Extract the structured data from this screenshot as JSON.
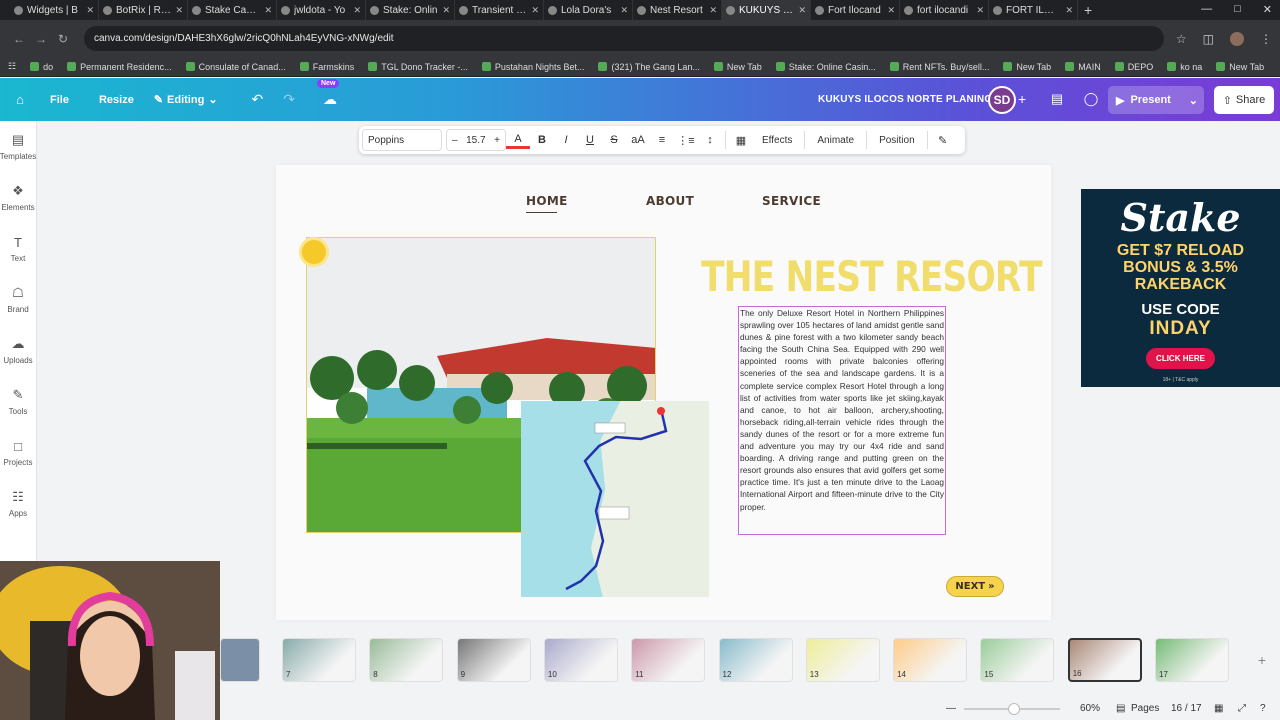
{
  "browser": {
    "tabs": [
      {
        "label": "Widgets | B",
        "active": false
      },
      {
        "label": "BotRix | Raffl",
        "active": false
      },
      {
        "label": "Stake Casino",
        "active": false
      },
      {
        "label": "jwldota - Yo",
        "active": false
      },
      {
        "label": "Stake: Onlin",
        "active": false
      },
      {
        "label": "Transient Ho",
        "active": false
      },
      {
        "label": "Lola Dora's",
        "active": false
      },
      {
        "label": "Nest Resort",
        "active": false
      },
      {
        "label": "KUKUYS ILC",
        "active": true
      },
      {
        "label": "Fort Ilocand",
        "active": false
      },
      {
        "label": "fort ilocandi",
        "active": false
      },
      {
        "label": "FORT ILOCA",
        "active": false
      }
    ],
    "url": "canva.com/design/DAHE3hX6glw/2ricQ0hNLah4EyVNG-xNWg/edit",
    "bookmarks": [
      "do",
      "Permanent Residenc...",
      "Consulate of Canad...",
      "Farmskins",
      "TGL Dono Tracker -...",
      "Pustahan Nights Bet...",
      "(321) The Gang Lan...",
      "New Tab",
      "Stake: Online Casin...",
      "Rent NFTs. Buy/sell...",
      "New Tab",
      "MAIN",
      "DEPO",
      "ko na",
      "New Tab"
    ]
  },
  "header": {
    "file": "File",
    "resize": "Resize",
    "editing": "Editing",
    "new_badge": "New",
    "design_title": "KUKUYS ILOCOS NORTE PLANING",
    "user_initials": "SD",
    "present": "Present",
    "share": "Share"
  },
  "sidebar": [
    {
      "label": "Templates",
      "icon": "templates-icon"
    },
    {
      "label": "Elements",
      "icon": "elements-icon"
    },
    {
      "label": "Text",
      "icon": "text-icon"
    },
    {
      "label": "Brand",
      "icon": "brand-icon"
    },
    {
      "label": "Uploads",
      "icon": "uploads-icon"
    },
    {
      "label": "Tools",
      "icon": "tools-icon"
    },
    {
      "label": "Projects",
      "icon": "projects-icon"
    },
    {
      "label": "Apps",
      "icon": "apps-icon"
    }
  ],
  "toolbar": {
    "font": "Poppins",
    "font_size": "15.7",
    "effects": "Effects",
    "animate": "Animate",
    "position": "Position"
  },
  "slide": {
    "nav_home": "HOME",
    "nav_about": "ABOUT",
    "nav_service": "SERVICE",
    "title": "THE NEST RESORT",
    "description": "The only Deluxe Resort Hotel in Northern Philippines sprawling over 105 hectares of land amidst gentle sand dunes & pine forest with a two kilometer sandy beach facing the South China Sea. Equipped with 290 well appointed rooms with private balconies offering sceneries of the sea and landscape gardens. It is a complete service complex Resort Hotel through a long list of activities from water sports like jet skiing,kayak and canoe, to hot air balloon, archery,shooting, horseback riding,all-terrain vehicle rides through the sandy dunes of the resort or for a more extreme fun and adventure you may try our 4x4 ride and sand boarding. A driving range and putting green on the resort grounds also ensures that avid golfers get some practice time. It's just a ten minute drive to the Laoag International Airport and fifteen-minute drive to the City proper.",
    "next": "NEXT"
  },
  "ad": {
    "logo": "Stake",
    "headline": "GET $7 RELOAD BONUS & 3.5% RAKEBACK",
    "use_code": "USE CODE",
    "code": "INDAY",
    "button": "CLICK HERE",
    "fine_print": "18+ | T&C apply"
  },
  "filmstrip": {
    "pages": [
      "7",
      "8",
      "9",
      "10",
      "11",
      "12",
      "13",
      "14",
      "15",
      "16",
      "17"
    ],
    "active_page": "16"
  },
  "status": {
    "zoom": "60%",
    "pages_label": "Pages",
    "page_count": "16 / 17"
  },
  "colors": {
    "title_yellow": "#f0dd6c",
    "nav_brown": "#4d3b30",
    "selection_purple": "#c26ad6",
    "canva_gradient_start": "#1ab7d0",
    "canva_gradient_end": "#7b3bd6"
  }
}
